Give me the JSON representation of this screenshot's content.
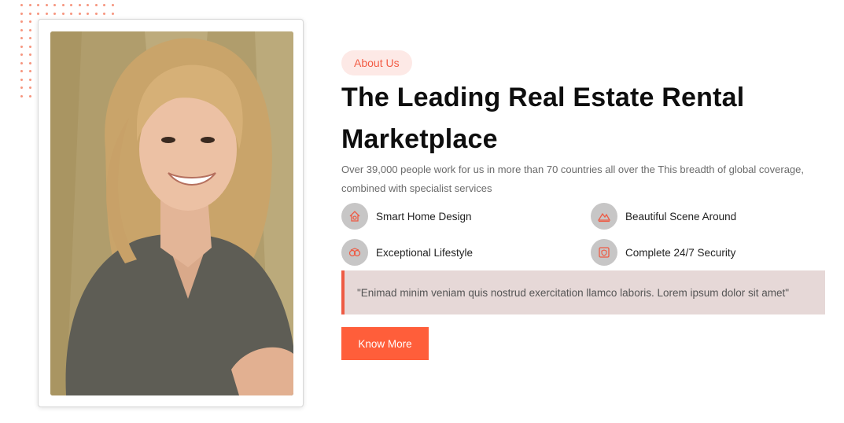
{
  "about": {
    "badge": "About Us",
    "title_line1": "The Leading Real Estate Rental",
    "title_line2": "Marketplace",
    "description_line1": "Over 39,000 people work for us in more than 70 countries all over the This breadth of global coverage,",
    "description_line2": "combined with specialist services"
  },
  "features": [
    {
      "label": "Smart Home Design",
      "icon": "smart-home-icon"
    },
    {
      "label": "Beautiful Scene Around",
      "icon": "scene-icon"
    },
    {
      "label": "Exceptional Lifestyle",
      "icon": "lifestyle-icon"
    },
    {
      "label": "Complete 24/7 Security",
      "icon": "security-icon"
    }
  ],
  "quote": "\"Enimad minim veniam quis nostrud exercitation llamco laboris. Lorem ipsum dolor sit amet\"",
  "cta": {
    "label": "Know More"
  },
  "colors": {
    "accent": "#ff5e3a",
    "badge_bg": "#fde9e6",
    "quote_bg": "#e6d8d7",
    "icon_bg": "#c7c6c6"
  }
}
